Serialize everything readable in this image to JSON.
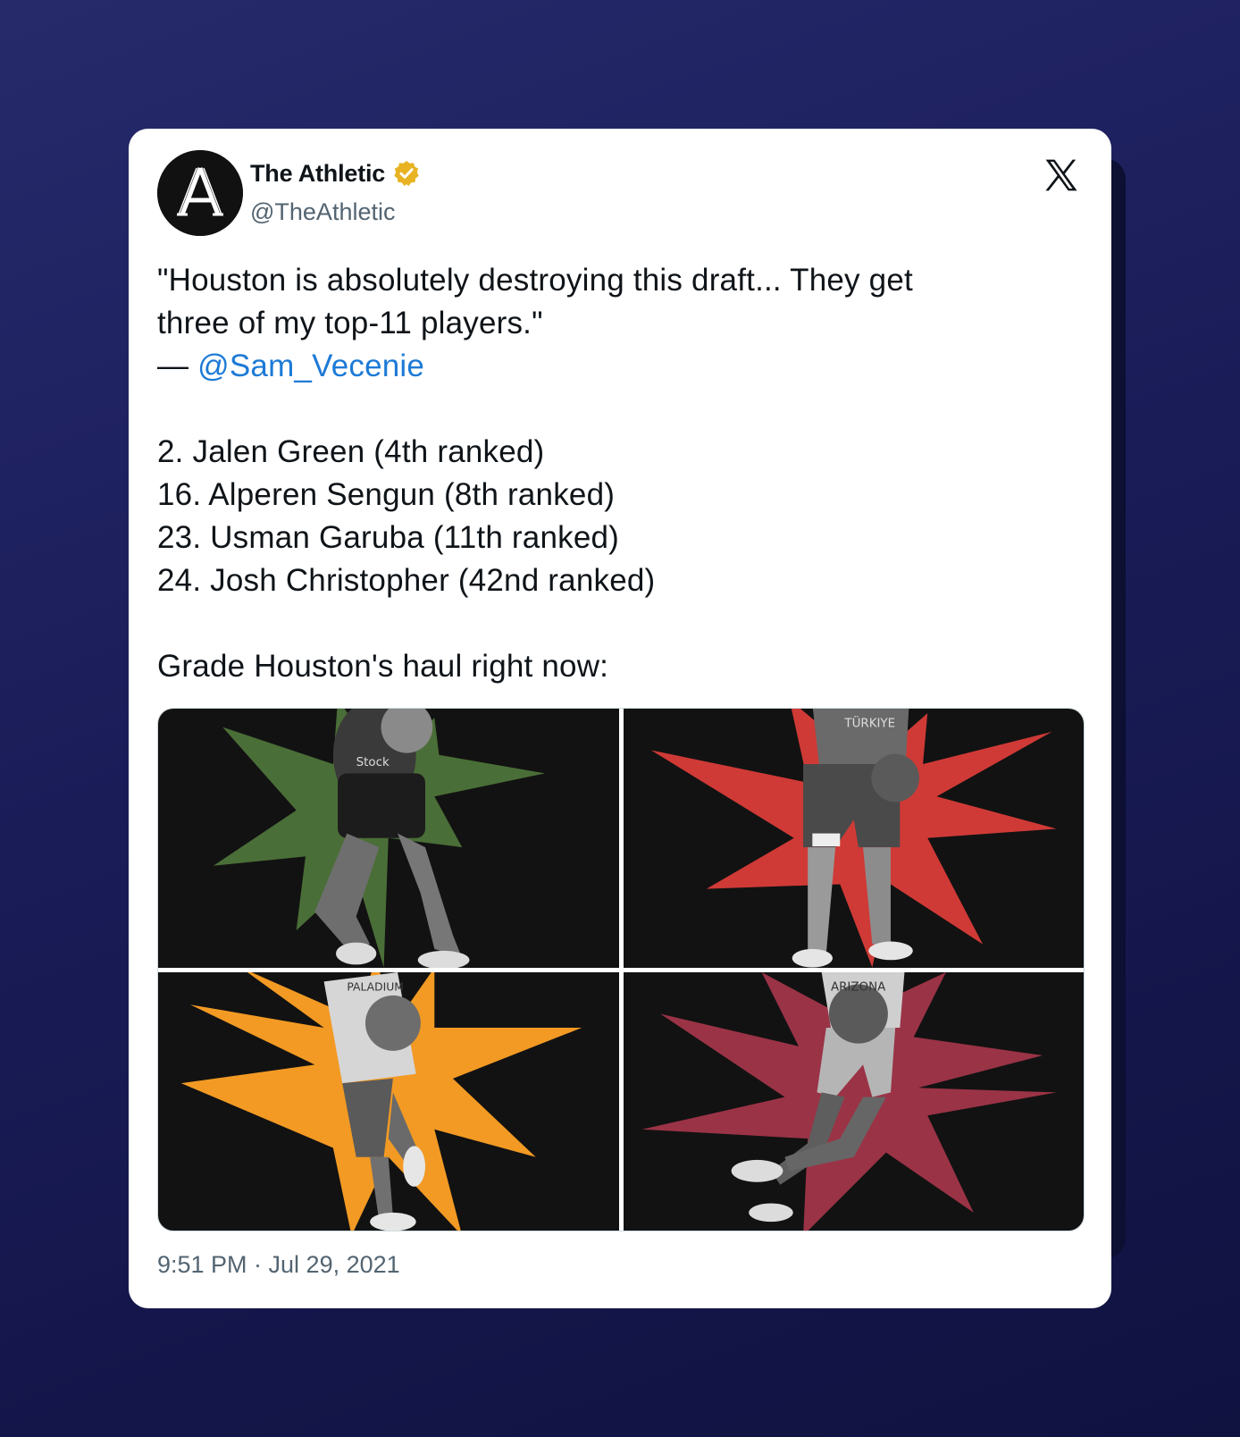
{
  "author": {
    "name": "The Athletic",
    "handle": "@TheAthletic",
    "avatar_letter": "A",
    "verified": true,
    "verified_icon": "verified-badge-icon",
    "verified_color": "#e8b323"
  },
  "platform_icon": "x-logo-icon",
  "tweet": {
    "quote_line1": "\"Houston is absolutely destroying this draft... They get",
    "quote_line2": "three of my top-11 players.\"",
    "attribution_dash": "— ",
    "attribution_mention": "@Sam_Vecenie",
    "picks": [
      "2. Jalen Green (4th ranked)",
      "16. Alperen Sengun (8th ranked)",
      "23. Usman Garuba (11th ranked)",
      "24. Josh Christopher (42nd ranked)"
    ],
    "closing": "Grade Houston's haul right now:"
  },
  "media": {
    "tiles": [
      {
        "name": "green-starburst",
        "color": "#4a6e37",
        "jersey_text": "Stock"
      },
      {
        "name": "red-starburst",
        "color": "#cf3a36",
        "jersey_text": "TÜRKIYE"
      },
      {
        "name": "orange-starburst",
        "color": "#f29a24",
        "jersey_text": "PALADIUM"
      },
      {
        "name": "maroon-starburst",
        "color": "#9a3346",
        "jersey_text": "ARIZONA"
      }
    ]
  },
  "timestamp": "9:51 PM · Jul 29, 2021",
  "colors": {
    "mention": "#1d7ad6",
    "text": "#0f1419",
    "muted": "#536471"
  }
}
